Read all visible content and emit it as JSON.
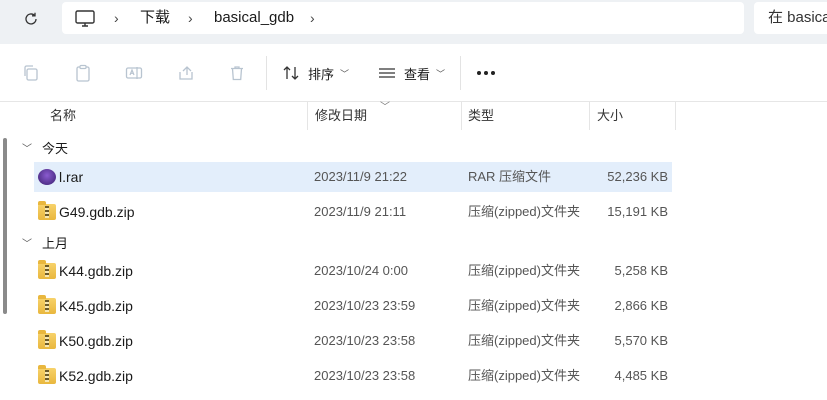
{
  "address": {
    "breadcrumbs": [
      "下载",
      "basical_gdb"
    ],
    "search_placeholder": "在 basical_gdb 中搜索"
  },
  "toolbar": {
    "sort_label": "排序",
    "view_label": "查看"
  },
  "columns": {
    "name": "名称",
    "date": "修改日期",
    "type": "类型",
    "size": "大小"
  },
  "groups": [
    {
      "label": "今天",
      "files": [
        {
          "name": "l.rar",
          "date": "2023/11/9 21:22",
          "type": "RAR 压缩文件",
          "size": "52,236 KB",
          "icon": "rar-icon",
          "selected": true
        },
        {
          "name": "G49.gdb.zip",
          "date": "2023/11/9 21:11",
          "type": "压缩(zipped)文件夹",
          "size": "15,191 KB",
          "icon": "zip-folder-icon",
          "selected": false
        }
      ]
    },
    {
      "label": "上月",
      "files": [
        {
          "name": "K44.gdb.zip",
          "date": "2023/10/24 0:00",
          "type": "压缩(zipped)文件夹",
          "size": "5,258 KB",
          "icon": "zip-folder-icon",
          "selected": false
        },
        {
          "name": "K45.gdb.zip",
          "date": "2023/10/23 23:59",
          "type": "压缩(zipped)文件夹",
          "size": "2,866 KB",
          "icon": "zip-folder-icon",
          "selected": false
        },
        {
          "name": "K50.gdb.zip",
          "date": "2023/10/23 23:58",
          "type": "压缩(zipped)文件夹",
          "size": "5,570 KB",
          "icon": "zip-folder-icon",
          "selected": false
        },
        {
          "name": "K52.gdb.zip",
          "date": "2023/10/23 23:58",
          "type": "压缩(zipped)文件夹",
          "size": "4,485 KB",
          "icon": "zip-folder-icon",
          "selected": false
        }
      ]
    }
  ],
  "colors": {
    "selected_row": "#e3eefb",
    "address_bar_bg": "#eef1f4"
  }
}
